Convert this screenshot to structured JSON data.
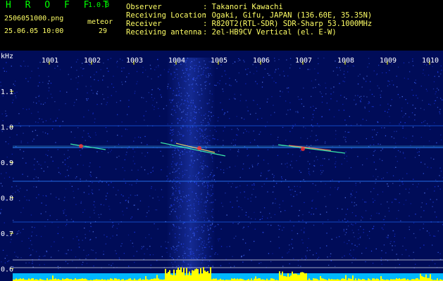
{
  "app": {
    "name": "H R O F F T",
    "version": "1.0.0"
  },
  "file": "2506051000.png",
  "datetime": "25.06.05 10:00",
  "meteor": {
    "label": "meteor",
    "count": "29"
  },
  "info": [
    {
      "key": "Observer",
      "value": ": Takanori Kawachi"
    },
    {
      "key": "Receiving Location",
      "value": ": Ogaki, Gifu, JAPAN (136.60E, 35.35N)"
    },
    {
      "key": "Receiver",
      "value": ": R820T2(RTL-SDR) SDR-Sharp 53.1000MHz"
    },
    {
      "key": "Receiving antenna",
      "value": ": 2el-HB9CV Vertical (el. E-W)"
    }
  ],
  "axes": {
    "y_unit": "kHz",
    "y_ticks": [
      "1.1",
      "1.0",
      "0.9",
      "0.8",
      "0.7",
      "0.6"
    ],
    "x_ticks": [
      "1001",
      "1002",
      "1003",
      "1004",
      "1005",
      "1006",
      "1007",
      "1008",
      "1009",
      "1010"
    ]
  },
  "colors": {
    "background": "#000c58",
    "tick": "#ffff00",
    "label": "#ffffff"
  }
}
